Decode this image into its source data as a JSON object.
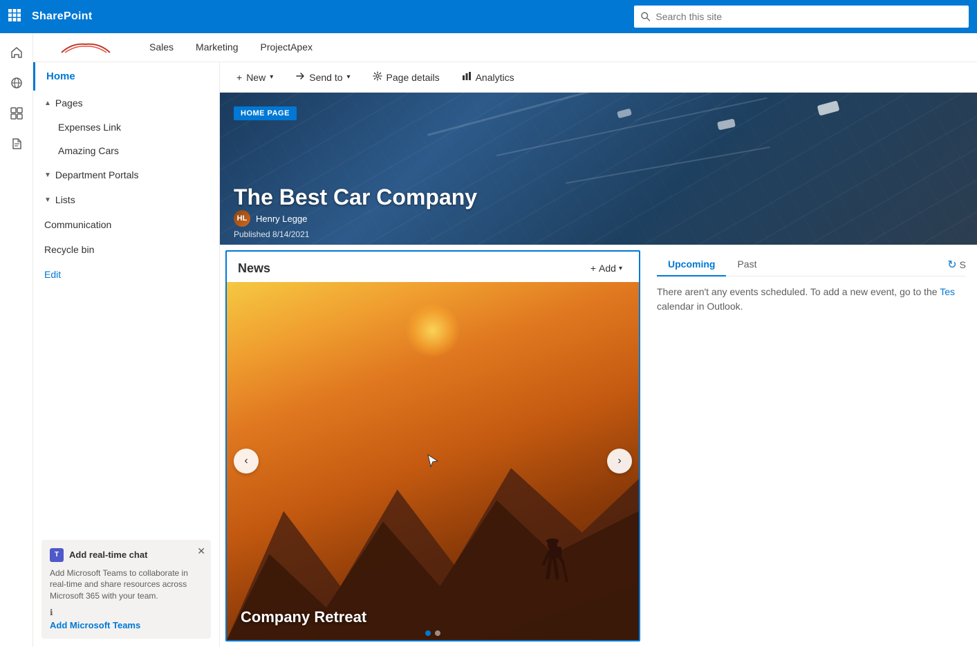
{
  "topbar": {
    "waffle_label": "⊞",
    "title": "SharePoint",
    "search_placeholder": "Search this site"
  },
  "left_rail": {
    "icons": [
      {
        "name": "home-icon",
        "symbol": "⌂"
      },
      {
        "name": "globe-icon",
        "symbol": "🌐"
      },
      {
        "name": "grid-icon",
        "symbol": "⊞"
      },
      {
        "name": "document-icon",
        "symbol": "📄"
      }
    ]
  },
  "tabs": [
    {
      "label": "Sales"
    },
    {
      "label": "Marketing"
    },
    {
      "label": "ProjectApex"
    }
  ],
  "sidebar": {
    "home_label": "Home",
    "pages_label": "Pages",
    "pages_items": [
      {
        "label": "Expenses Link"
      },
      {
        "label": "Amazing Cars"
      }
    ],
    "dept_portals_label": "Department Portals",
    "lists_label": "Lists",
    "communication_label": "Communication",
    "recycle_bin_label": "Recycle bin",
    "edit_label": "Edit",
    "bottom_card": {
      "title": "Add real-time chat",
      "body": "Add Microsoft Teams to collaborate in real-time and share resources across Microsoft 365 with your team.",
      "add_link": "Add Microsoft Teams"
    }
  },
  "command_bar": {
    "new_label": "New",
    "send_to_label": "Send to",
    "page_details_label": "Page details",
    "analytics_label": "Analytics"
  },
  "hero": {
    "badge": "HOME PAGE",
    "title": "The Best Car Company",
    "author_name": "Henry Legge",
    "author_initials": "HL",
    "published": "Published 8/14/2021"
  },
  "news": {
    "title": "News",
    "add_label": "Add",
    "carousel_caption": "Company Retreat",
    "dots": [
      true,
      false
    ],
    "prev_label": "‹",
    "next_label": "›"
  },
  "events": {
    "upcoming_label": "Upcoming",
    "past_label": "Past",
    "empty_text": "There aren't any events scheduled. To add a new event, go to the ",
    "empty_link": "Tes",
    "empty_text2": "calendar in Outlook."
  }
}
